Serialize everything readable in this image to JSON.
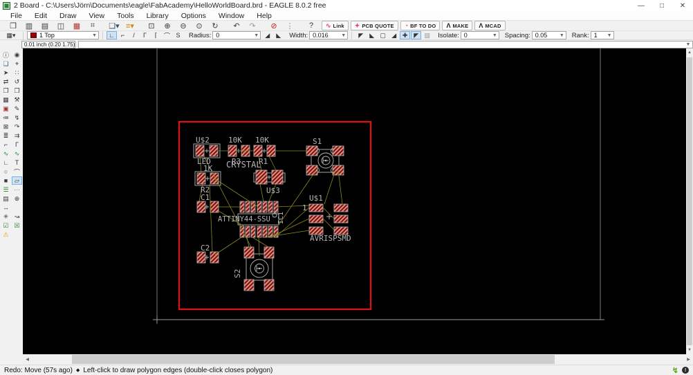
{
  "window": {
    "title": "2 Board - C:\\Users\\Jörn\\Documents\\eagle\\FabAcademy\\HelloWorldBoard.brd - EAGLE 8.0.2 free",
    "minimize": "—",
    "maximize": "□",
    "close": "✕"
  },
  "menus": [
    "File",
    "Edit",
    "Draw",
    "View",
    "Tools",
    "Library",
    "Options",
    "Window",
    "Help"
  ],
  "toolbar": {
    "icons": [
      {
        "n": "open-icon",
        "g": "❒"
      },
      {
        "n": "save-icon",
        "g": "▥"
      },
      {
        "n": "print-icon",
        "g": "▤"
      },
      {
        "n": "export-image-icon",
        "g": "◫"
      },
      {
        "n": "cam-processor-icon",
        "g": "▦",
        "c": "#b23333"
      },
      {
        "n": "library-icon",
        "g": "⌗"
      },
      {
        "sep": true
      },
      {
        "n": "schematic-switch-icon",
        "g": "❏▾",
        "c": "#33506e"
      },
      {
        "n": "layer-list-icon",
        "g": "≡▾",
        "c": "#d58512"
      },
      {
        "sep": true
      },
      {
        "n": "zoom-fit-icon",
        "g": "⊡"
      },
      {
        "n": "zoom-in-icon",
        "g": "⊕"
      },
      {
        "n": "zoom-out-icon",
        "g": "⊖"
      },
      {
        "n": "zoom-select-icon",
        "g": "⊙"
      },
      {
        "n": "zoom-redraw-icon",
        "g": "↻"
      },
      {
        "sep": true
      },
      {
        "n": "undo-icon",
        "g": "↶"
      },
      {
        "n": "redo-icon",
        "g": "↷",
        "c": "#9a9a9a"
      },
      {
        "sep": true
      },
      {
        "n": "stop-icon",
        "g": "⊘",
        "c": "#c42222"
      },
      {
        "n": "options-dots-icon",
        "g": "⋮",
        "c": "#8a8a8a"
      },
      {
        "sep": true
      },
      {
        "n": "help-icon",
        "g": "?"
      }
    ],
    "actions": [
      {
        "n": "fusion-link-button",
        "icon": "∿",
        "ic": "#e0487b",
        "label": "Link"
      },
      {
        "n": "pcb-quote-button",
        "icon": "✦",
        "ic": "#e0487b",
        "label": "PCB QUOTE"
      },
      {
        "n": "bf-todo-button",
        "icon": "◔",
        "ic": "#e0487b",
        "label": "BF TO DO"
      },
      {
        "n": "make-button",
        "icon": "Λ",
        "ic": "#111111",
        "label": "MAKE"
      },
      {
        "n": "mcad-button",
        "icon": "Λ",
        "ic": "#111111",
        "label": "MCAD"
      }
    ]
  },
  "params": {
    "grid_icon": "▦▾",
    "layer_value": "1 Top",
    "layer_color": "#9b0000",
    "bend_styles": [
      {
        "n": "bend-style-1",
        "g": "∟",
        "active": true
      },
      {
        "n": "bend-style-2",
        "g": "⌐"
      },
      {
        "n": "bend-style-3",
        "g": "/"
      },
      {
        "n": "bend-style-4",
        "g": "Γ"
      },
      {
        "n": "bend-style-5",
        "g": "⌈"
      },
      {
        "n": "bend-style-6",
        "g": "⌒"
      },
      {
        "n": "bend-style-7",
        "g": "S"
      }
    ],
    "radius_label": "Radius:",
    "radius_value": "0",
    "miter_styles": [
      {
        "n": "miter-style-1",
        "g": "◢"
      },
      {
        "n": "miter-style-2",
        "g": "◣"
      }
    ],
    "width_label": "Width:",
    "width_value": "0.016",
    "pour_styles": [
      {
        "n": "pour-solid",
        "g": "◤"
      },
      {
        "n": "pour-hatch",
        "g": "◣"
      },
      {
        "n": "pour-outline",
        "g": "▢"
      },
      {
        "n": "thermal-style",
        "g": "◢"
      },
      {
        "n": "thermal-cross",
        "g": "✚",
        "active": true
      },
      {
        "n": "orphans-toggle",
        "g": "◤",
        "active": true
      },
      {
        "n": "hatch-grid",
        "g": "▨",
        "c": "#9a9a9a"
      }
    ],
    "isolate_label": "Isolate:",
    "isolate_value": "0",
    "spacing_label": "Spacing:",
    "spacing_value": "0.05",
    "rank_label": "Rank:",
    "rank_value": "1"
  },
  "coordbar": {
    "position": "0.01 inch (0.20 1.75)"
  },
  "palette": {
    "cells": [
      {
        "n": "info-icon",
        "g": "ⓘ"
      },
      {
        "n": "display-icon",
        "g": "◉"
      },
      {
        "n": "layer-settings-icon",
        "g": "❏",
        "c": "#355a7a"
      },
      {
        "n": "mark-icon",
        "g": "⌖"
      },
      {
        "n": "move-icon",
        "g": "➤"
      },
      {
        "n": "group-icon",
        "g": "∷"
      },
      {
        "n": "mirror-icon",
        "g": "⇄"
      },
      {
        "n": "rotate-icon",
        "g": "↺"
      },
      {
        "n": "copy-icon",
        "g": "❐"
      },
      {
        "n": "paste-icon",
        "g": "❒"
      },
      {
        "n": "delete-icon",
        "g": "▦"
      },
      {
        "n": "wrench-icon",
        "g": "⚒"
      },
      {
        "n": "replace-icon",
        "g": "▣",
        "c": "#a33333"
      },
      {
        "n": "name-icon",
        "g": "✎"
      },
      {
        "n": "value-icon",
        "g": "≔"
      },
      {
        "n": "smash-icon",
        "g": "↯"
      },
      {
        "n": "lock-icon",
        "g": "⊠"
      },
      {
        "n": "optimize-icon",
        "g": "↷"
      },
      {
        "n": "meander-icon",
        "g": "≣"
      },
      {
        "n": "split-icon",
        "g": "⇉"
      },
      {
        "n": "bend-icon",
        "g": "⌐"
      },
      {
        "n": "miter-icon",
        "g": "Γ"
      },
      {
        "n": "route-icon",
        "g": "∿",
        "c": "#2a7f2a"
      },
      {
        "n": "ripup-icon",
        "g": "∿",
        "c": "#2a7f2a"
      },
      {
        "n": "wire-icon",
        "g": "∟"
      },
      {
        "n": "text-icon",
        "g": "T"
      },
      {
        "n": "circle-icon",
        "g": "○"
      },
      {
        "n": "arc-icon",
        "g": "⌒"
      },
      {
        "n": "rect-icon",
        "g": "■"
      },
      {
        "n": "polygon-icon",
        "g": "▱",
        "active": true
      },
      {
        "n": "via-icon",
        "g": "☰",
        "c": "#2a7f2a"
      },
      {
        "n": "signal-icon",
        "g": "⋯",
        "c": "#8a8a2a"
      },
      {
        "n": "smd-icon",
        "g": "▤"
      },
      {
        "n": "hole-icon",
        "g": "⊕"
      },
      {
        "n": "dimension-icon",
        "g": "↔"
      },
      {
        "blank": true,
        "g": ""
      },
      {
        "n": "ratsnest-icon",
        "g": "✳"
      },
      {
        "n": "autorouter-icon",
        "g": "↝"
      },
      {
        "n": "drc-icon",
        "g": "☑",
        "c": "#2a7f2a"
      },
      {
        "n": "erc-icon",
        "g": "☒",
        "c": "#2a7f2a"
      },
      {
        "n": "errors-icon",
        "g": "⚠",
        "c": "#d89b00"
      },
      {
        "blank": true,
        "g": ""
      }
    ]
  },
  "board": {
    "labels": {
      "u2_name": "U$2",
      "u2_value": "LED",
      "r3_value": "10K",
      "r3_name": "R3",
      "r1_value": "10K",
      "r1_name": "R1",
      "s1_name": "S1",
      "crystal": "CRYSTAL",
      "u3_name": "U$3",
      "r2_value": "1K",
      "r2_name": "R2",
      "c1_name": "C1",
      "ic1_value": "ATTINY44-SSU",
      "ic1_name": "IC1",
      "u1_name": "U$1",
      "u1_pin1": "1",
      "u1_value": "AVRISPSMD",
      "c2_name": "C2",
      "s2_name": "S2"
    },
    "colors": {
      "board_outline": "#d01616",
      "pad_base": "#6e1414",
      "pad_stripe": "#e98a7a",
      "silkscreen": "#b8b8b8",
      "ratsnest": "#8a8a20",
      "frame": "#7c7c7c"
    }
  },
  "scroll": {
    "up": "▲",
    "down": "▼",
    "left": "◀",
    "right": "▶"
  },
  "statusbar": {
    "left": "Redo: Move (57s ago)",
    "sep": "◆",
    "hint": "Left-click to draw polygon edges (double-click closes polygon)",
    "bolt": "↯",
    "alert": "!"
  }
}
